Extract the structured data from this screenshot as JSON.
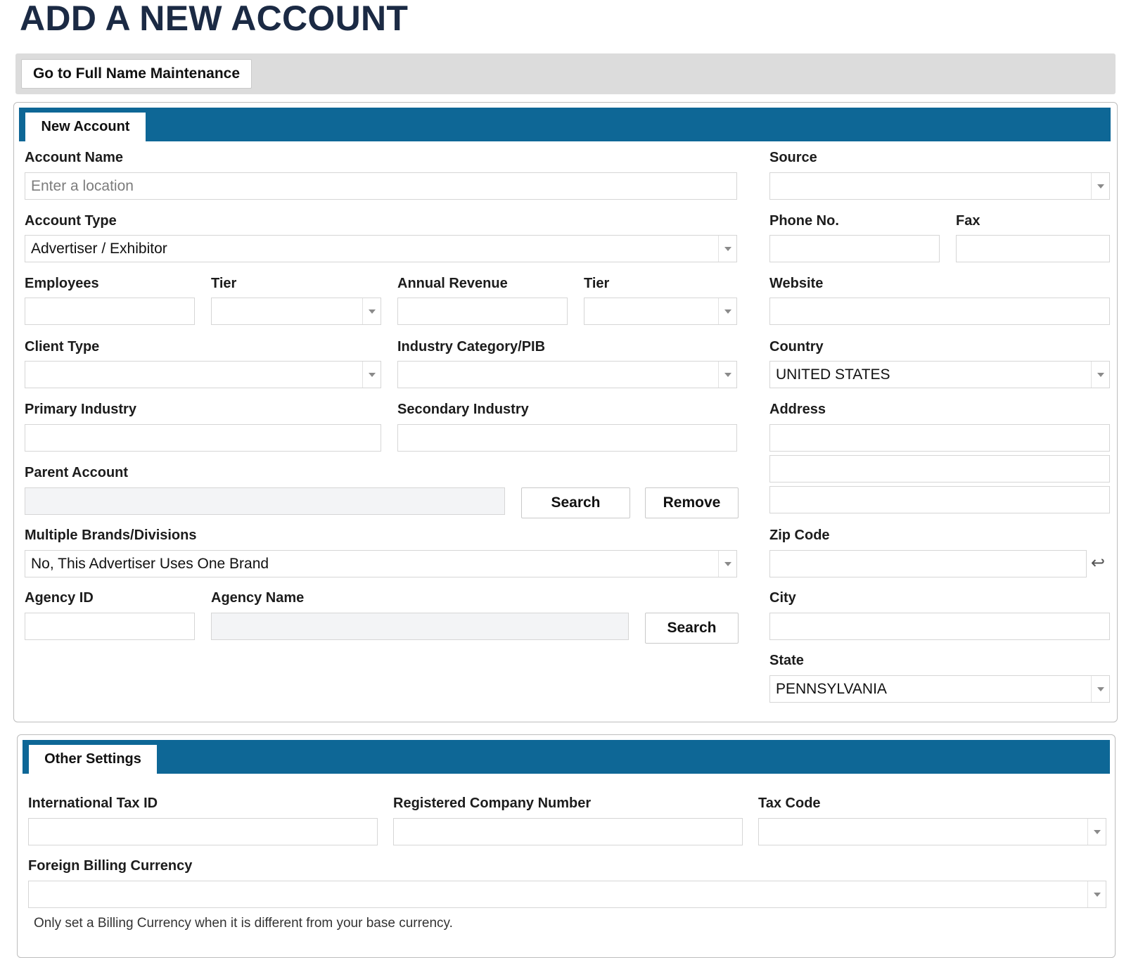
{
  "page": {
    "title": "ADD A NEW ACCOUNT"
  },
  "toolbar": {
    "full_name_label": "Go to Full Name Maintenance"
  },
  "new_account": {
    "tab_label": "New Account",
    "account_name": {
      "label": "Account Name",
      "placeholder": "Enter a location",
      "value": ""
    },
    "account_type": {
      "label": "Account Type",
      "value": "Advertiser / Exhibitor"
    },
    "employees": {
      "label": "Employees",
      "value": ""
    },
    "employees_tier": {
      "label": "Tier",
      "value": ""
    },
    "annual_revenue": {
      "label": "Annual Revenue",
      "value": ""
    },
    "revenue_tier": {
      "label": "Tier",
      "value": ""
    },
    "client_type": {
      "label": "Client Type",
      "value": ""
    },
    "industry_category": {
      "label": "Industry Category/PIB",
      "value": ""
    },
    "primary_industry": {
      "label": "Primary Industry",
      "value": ""
    },
    "secondary_industry": {
      "label": "Secondary Industry",
      "value": ""
    },
    "parent_account": {
      "label": "Parent Account",
      "value": "",
      "search_label": "Search",
      "remove_label": "Remove"
    },
    "multiple_brands": {
      "label": "Multiple Brands/Divisions",
      "value": "No, This Advertiser Uses One Brand"
    },
    "agency_id": {
      "label": "Agency ID",
      "value": ""
    },
    "agency_name": {
      "label": "Agency Name",
      "value": "",
      "search_label": "Search"
    },
    "source": {
      "label": "Source",
      "value": ""
    },
    "phone": {
      "label": "Phone No.",
      "value": ""
    },
    "fax": {
      "label": "Fax",
      "value": ""
    },
    "website": {
      "label": "Website",
      "value": ""
    },
    "country": {
      "label": "Country",
      "value": "UNITED STATES"
    },
    "address": {
      "label": "Address",
      "line1": "",
      "line2": "",
      "line3": ""
    },
    "zip_code": {
      "label": "Zip Code",
      "value": "",
      "icon": "enter-icon"
    },
    "city": {
      "label": "City",
      "value": ""
    },
    "state": {
      "label": "State",
      "value": "PENNSYLVANIA"
    }
  },
  "other_settings": {
    "tab_label": "Other Settings",
    "international_tax_id": {
      "label": "International Tax ID",
      "value": ""
    },
    "registered_company_number": {
      "label": "Registered Company Number",
      "value": ""
    },
    "tax_code": {
      "label": "Tax Code",
      "value": ""
    },
    "foreign_billing_currency": {
      "label": "Foreign Billing Currency",
      "value": "",
      "hint": "Only set a Billing Currency when it is different from your base currency."
    }
  },
  "colors": {
    "header_bar": "#0e6796",
    "title": "#1b2a44",
    "toolbar_bg": "#dcdcdc"
  }
}
